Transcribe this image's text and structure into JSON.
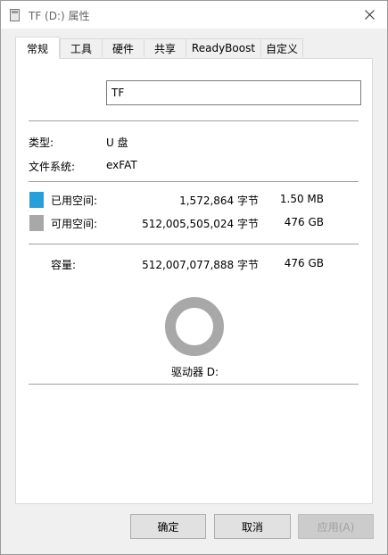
{
  "window": {
    "title": "TF (D:) 属性"
  },
  "tabs": [
    {
      "label": "常规",
      "active": true
    },
    {
      "label": "工具"
    },
    {
      "label": "硬件"
    },
    {
      "label": "共享"
    },
    {
      "label": "ReadyBoost"
    },
    {
      "label": "自定义"
    }
  ],
  "general": {
    "name_value": "TF",
    "type_label": "类型:",
    "type_value": "U 盘",
    "fs_label": "文件系统:",
    "fs_value": "exFAT",
    "used": {
      "label": "已用空间:",
      "bytes": "1,572,864 字节",
      "size": "1.50 MB",
      "color": "#26a0da"
    },
    "free": {
      "label": "可用空间:",
      "bytes": "512,005,505,024 字节",
      "size": "476 GB",
      "color": "#a8a8a8"
    },
    "capacity": {
      "label": "容量:",
      "bytes": "512,007,077,888 字节",
      "size": "476 GB"
    },
    "drive_label": "驱动器 D:",
    "used_fraction": 3.1e-06
  },
  "buttons": {
    "ok": "确定",
    "cancel": "取消",
    "apply": "应用(A)"
  }
}
